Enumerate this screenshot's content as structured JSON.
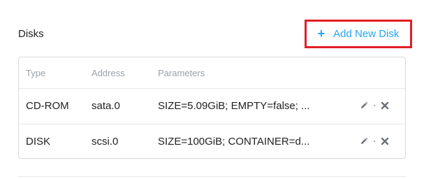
{
  "section": {
    "title": "Disks",
    "add_button": {
      "icon": "plus-icon",
      "label": "Add New Disk",
      "accent_color": "#22a5f7",
      "highlight_color": "#e21e26"
    }
  },
  "table": {
    "headers": [
      "Type",
      "Address",
      "Parameters"
    ],
    "rows": [
      {
        "type": "CD-ROM",
        "address": "sata.0",
        "parameters": "SIZE=5.09GiB; EMPTY=false; ...",
        "actions": [
          "edit-icon",
          "delete-icon"
        ]
      },
      {
        "type": "DISK",
        "address": "scsi.0",
        "parameters": "SIZE=100GiB; CONTAINER=d...",
        "actions": [
          "edit-icon",
          "delete-icon"
        ]
      }
    ]
  }
}
